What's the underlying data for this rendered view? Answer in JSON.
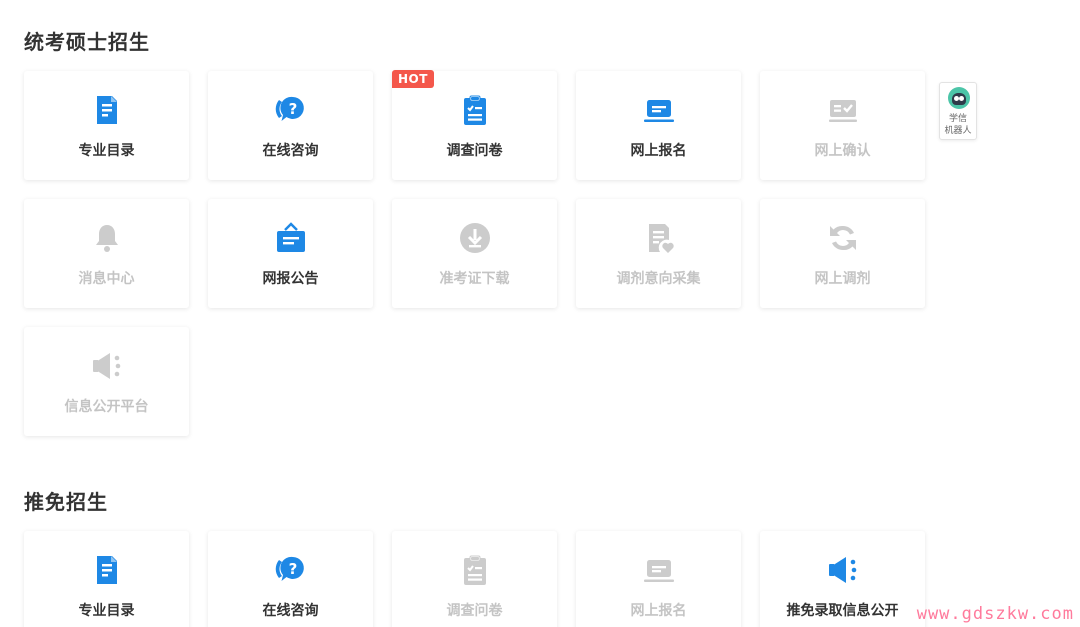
{
  "sections": [
    {
      "title": "统考硕士招生",
      "items": [
        {
          "label": "专业目录",
          "icon": "document-icon",
          "active": true
        },
        {
          "label": "在线咨询",
          "icon": "question-chat-icon",
          "active": true
        },
        {
          "label": "调查问卷",
          "icon": "clipboard-check-icon",
          "active": true,
          "badge": "HOT"
        },
        {
          "label": "网上报名",
          "icon": "laptop-icon",
          "active": true
        },
        {
          "label": "网上确认",
          "icon": "id-card-check-icon",
          "active": false
        },
        {
          "label": "消息中心",
          "icon": "bell-icon",
          "active": false
        },
        {
          "label": "网报公告",
          "icon": "announcement-box-icon",
          "active": true
        },
        {
          "label": "准考证下载",
          "icon": "download-circle-icon",
          "active": false
        },
        {
          "label": "调剂意向采集",
          "icon": "form-heart-icon",
          "active": false
        },
        {
          "label": "网上调剂",
          "icon": "refresh-icon",
          "active": false
        },
        {
          "label": "信息公开平台",
          "icon": "megaphone-icon",
          "active": false
        }
      ]
    },
    {
      "title": "推免招生",
      "items": [
        {
          "label": "专业目录",
          "icon": "document-icon",
          "active": true
        },
        {
          "label": "在线咨询",
          "icon": "question-chat-icon",
          "active": true
        },
        {
          "label": "调查问卷",
          "icon": "clipboard-check-icon",
          "active": false
        },
        {
          "label": "网上报名",
          "icon": "laptop-icon",
          "active": false
        },
        {
          "label": "推免录取信息公开",
          "icon": "megaphone-icon",
          "active": true
        }
      ]
    }
  ],
  "robot": {
    "line1": "学信",
    "line2": "机器人",
    "icon": "robot-avatar-icon"
  },
  "watermark": "www.gdszkw.com",
  "colors": {
    "accent": "#1e88e5",
    "disabled": "#cccccc",
    "hot": "#f4574b",
    "watermark": "#ff7a9c"
  }
}
